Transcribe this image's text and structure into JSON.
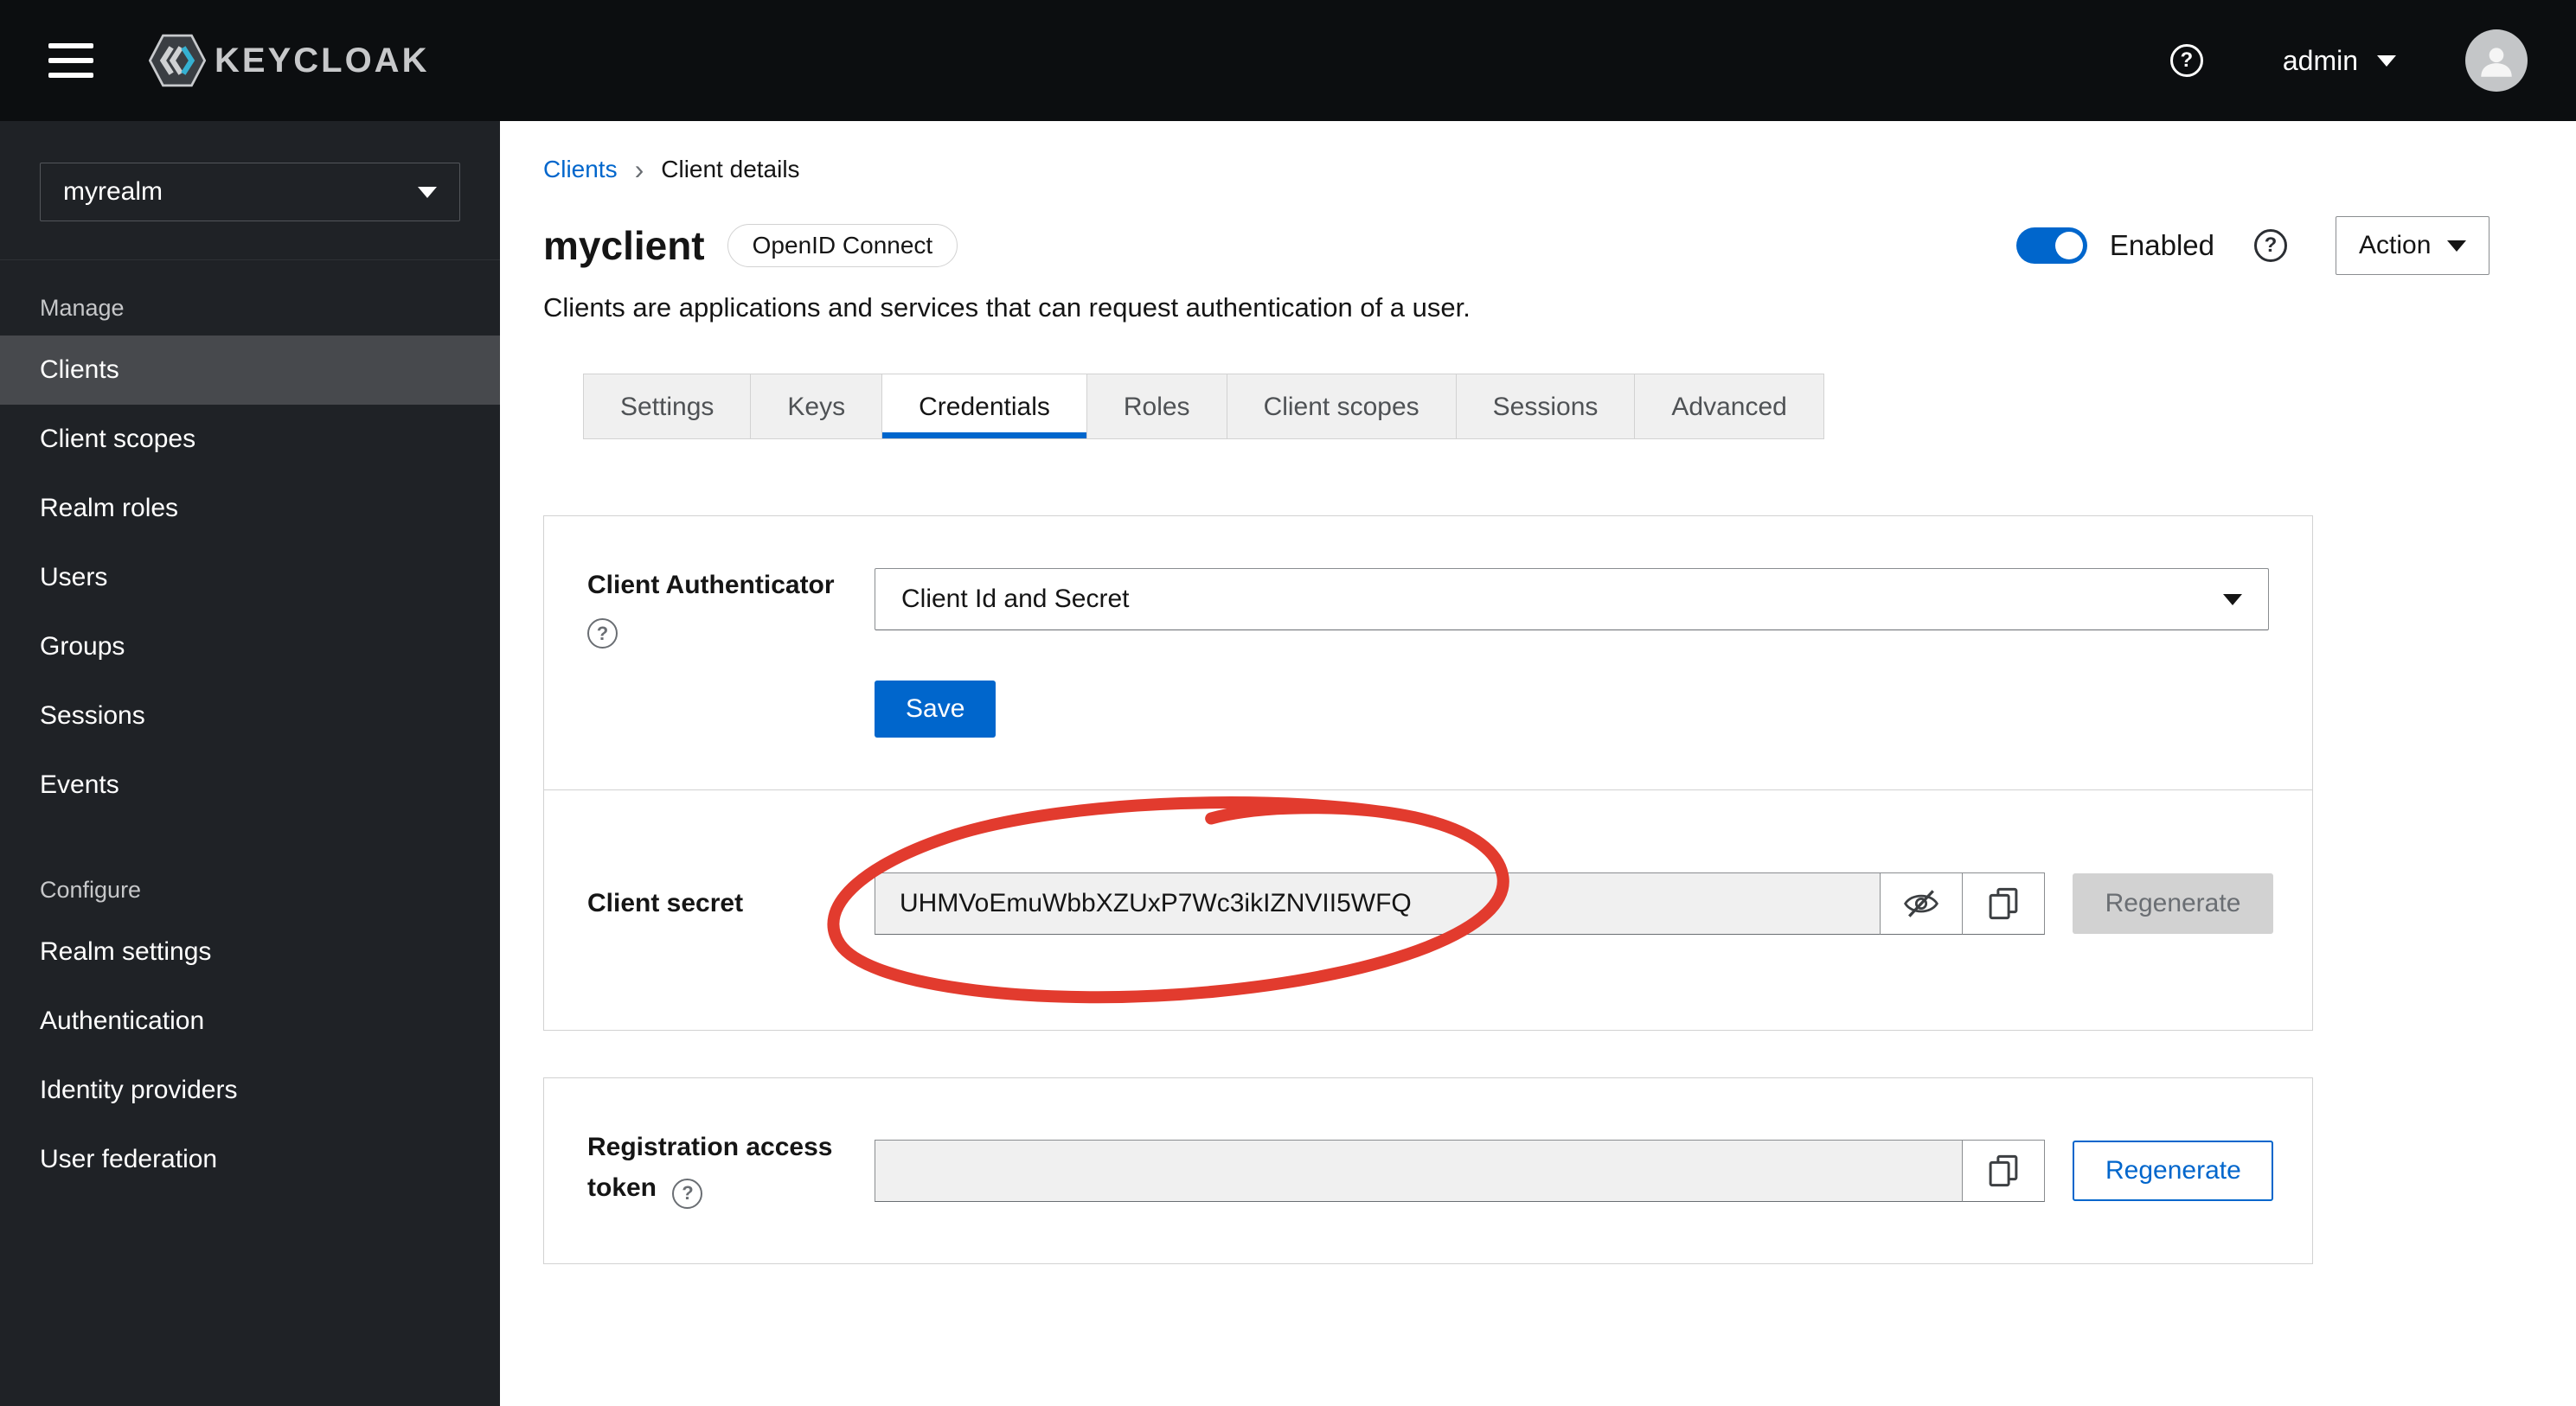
{
  "topbar": {
    "brand": "KEYCLOAK",
    "user_label": "admin"
  },
  "sidebar": {
    "realm": "myrealm",
    "manage_label": "Manage",
    "manage_items": [
      "Clients",
      "Client scopes",
      "Realm roles",
      "Users",
      "Groups",
      "Sessions",
      "Events"
    ],
    "configure_label": "Configure",
    "configure_items": [
      "Realm settings",
      "Authentication",
      "Identity providers",
      "User federation"
    ],
    "selected_item": "Clients"
  },
  "breadcrumb": {
    "parent": "Clients",
    "current": "Client details"
  },
  "header": {
    "title": "myclient",
    "protocol_badge": "OpenID Connect",
    "description": "Clients are applications and services that can request authentication of a user.",
    "enabled_label": "Enabled",
    "action_label": "Action"
  },
  "tabs": {
    "items": [
      "Settings",
      "Keys",
      "Credentials",
      "Roles",
      "Client scopes",
      "Sessions",
      "Advanced"
    ],
    "active": "Credentials"
  },
  "credentials": {
    "client_authenticator_label": "Client Authenticator",
    "client_authenticator_value": "Client Id and Secret",
    "save_label": "Save",
    "client_secret_label": "Client secret",
    "client_secret_value": "UHMVoEmuWbbXZUxP7Wc3ikIZNVII5WFQ",
    "regenerate_label": "Regenerate",
    "registration_token_label": "Registration access token",
    "registration_token_value": ""
  },
  "icons": {
    "question": "?",
    "chevron_right": "›"
  },
  "colors": {
    "primary": "#0066cc",
    "annotation": "#e23b2e",
    "masthead": "#0c0e10",
    "sidebar": "#1f2226"
  }
}
